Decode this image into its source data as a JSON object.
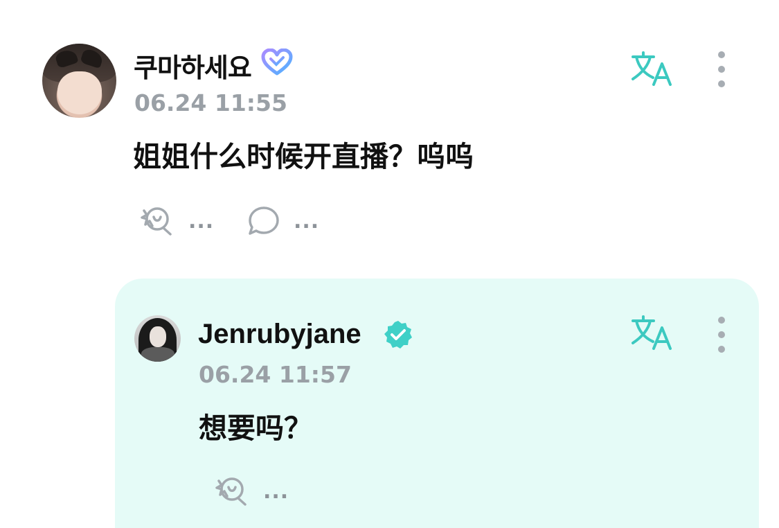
{
  "comment": {
    "username": "쿠마하세요",
    "timestamp": "06.24 11:55",
    "text": "姐姐什么时候开直播？呜呜",
    "reaction_count": "...",
    "reply_count": "..."
  },
  "reply": {
    "username": "Jenrubyjane",
    "timestamp": "06.24 11:57",
    "text": "想要吗？",
    "reaction_count": "..."
  },
  "icons": {
    "translate": "translate-icon",
    "more": "more-vertical-icon",
    "react": "smile-react-icon",
    "comment": "chat-bubble-icon",
    "membership_badge": "heart-badge-icon",
    "verified_badge": "verified-badge-icon"
  },
  "colors": {
    "accent": "#3cc9c0",
    "reply_background": "#e5fbf7",
    "muted_text": "#9aa0a6"
  }
}
